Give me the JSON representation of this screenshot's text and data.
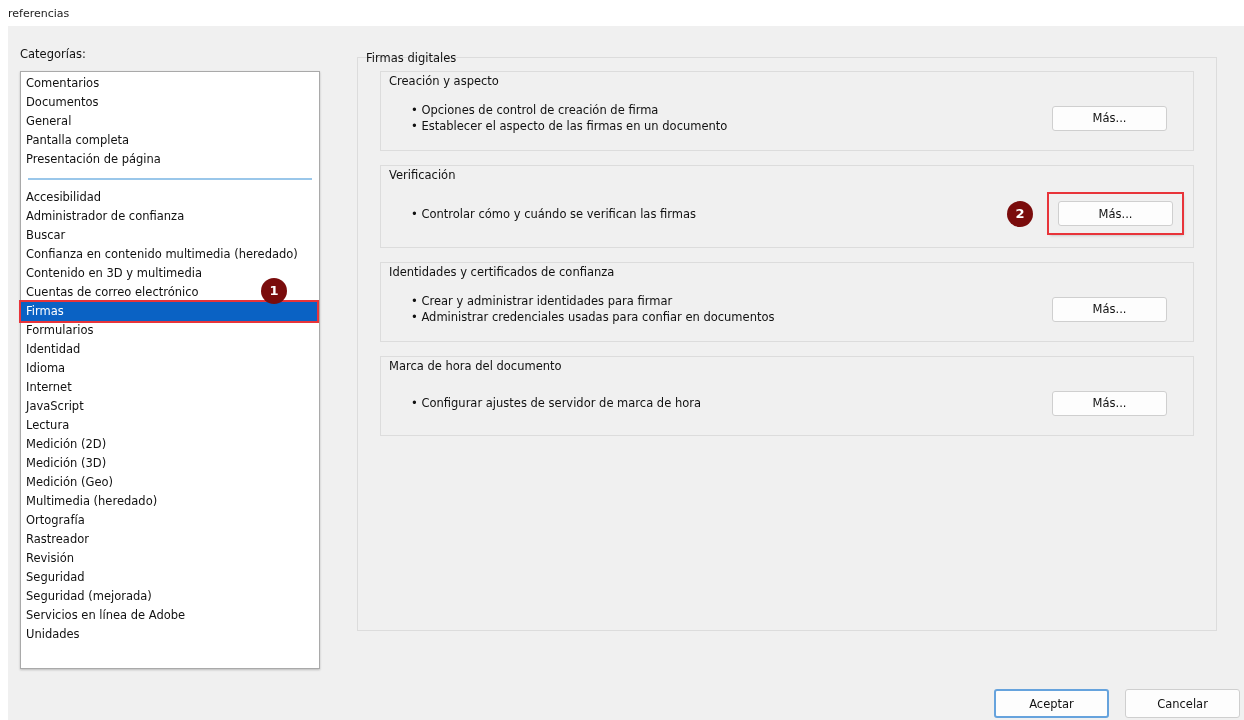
{
  "window": {
    "title": "referencias"
  },
  "categories": {
    "label": "Categorías:",
    "groups": [
      {
        "items": [
          {
            "label": "Comentarios",
            "selected": false,
            "highlighted": false
          },
          {
            "label": "Documentos",
            "selected": false,
            "highlighted": false
          },
          {
            "label": "General",
            "selected": false,
            "highlighted": false
          },
          {
            "label": "Pantalla completa",
            "selected": false,
            "highlighted": false
          },
          {
            "label": "Presentación de página",
            "selected": false,
            "highlighted": false
          }
        ]
      },
      {
        "items": [
          {
            "label": "Accesibilidad",
            "selected": false,
            "highlighted": false
          },
          {
            "label": "Administrador de confianza",
            "selected": false,
            "highlighted": false
          },
          {
            "label": "Buscar",
            "selected": false,
            "highlighted": false
          },
          {
            "label": "Confianza en contenido multimedia (heredado)",
            "selected": false,
            "highlighted": false
          },
          {
            "label": "Contenido en 3D y multimedia",
            "selected": false,
            "highlighted": false
          },
          {
            "label": "Cuentas de correo electrónico",
            "selected": false,
            "highlighted": false
          },
          {
            "label": "Firmas",
            "selected": true,
            "highlighted": true,
            "callout": "1"
          },
          {
            "label": "Formularios",
            "selected": false,
            "highlighted": false
          },
          {
            "label": "Identidad",
            "selected": false,
            "highlighted": false
          },
          {
            "label": "Idioma",
            "selected": false,
            "highlighted": false
          },
          {
            "label": "Internet",
            "selected": false,
            "highlighted": false
          },
          {
            "label": "JavaScript",
            "selected": false,
            "highlighted": false
          },
          {
            "label": "Lectura",
            "selected": false,
            "highlighted": false
          },
          {
            "label": "Medición (2D)",
            "selected": false,
            "highlighted": false
          },
          {
            "label": "Medición (3D)",
            "selected": false,
            "highlighted": false
          },
          {
            "label": "Medición (Geo)",
            "selected": false,
            "highlighted": false
          },
          {
            "label": "Multimedia (heredado)",
            "selected": false,
            "highlighted": false
          },
          {
            "label": "Ortografía",
            "selected": false,
            "highlighted": false
          },
          {
            "label": "Rastreador",
            "selected": false,
            "highlighted": false
          },
          {
            "label": "Revisión",
            "selected": false,
            "highlighted": false
          },
          {
            "label": "Seguridad",
            "selected": false,
            "highlighted": false
          },
          {
            "label": "Seguridad (mejorada)",
            "selected": false,
            "highlighted": false
          },
          {
            "label": "Servicios en línea de Adobe",
            "selected": false,
            "highlighted": false
          },
          {
            "label": "Unidades",
            "selected": false,
            "highlighted": false
          }
        ]
      }
    ]
  },
  "panel": {
    "title": "Firmas digitales",
    "sections": [
      {
        "title": "Creación y aspecto",
        "bullets": [
          "• Opciones de control de creación de firma",
          "• Establecer el aspecto de las firmas en un documento"
        ],
        "button": {
          "label": "Más...",
          "highlighted": false
        }
      },
      {
        "title": "Verificación",
        "bullets": [
          "• Controlar cómo y cuándo se verifican las firmas"
        ],
        "button": {
          "label": "Más...",
          "highlighted": true,
          "callout": "2"
        }
      },
      {
        "title": "Identidades y certificados de confianza",
        "bullets": [
          "• Crear y administrar identidades para firmar",
          "• Administrar credenciales usadas para confiar en documentos"
        ],
        "button": {
          "label": "Más...",
          "highlighted": false
        }
      },
      {
        "title": "Marca de hora del documento",
        "bullets": [
          "• Configurar ajustes de servidor de marca de hora"
        ],
        "button": {
          "label": "Más...",
          "highlighted": false
        }
      }
    ]
  },
  "buttons": [
    {
      "label": "Aceptar",
      "default": true
    },
    {
      "label": "Cancelar",
      "default": false
    }
  ]
}
